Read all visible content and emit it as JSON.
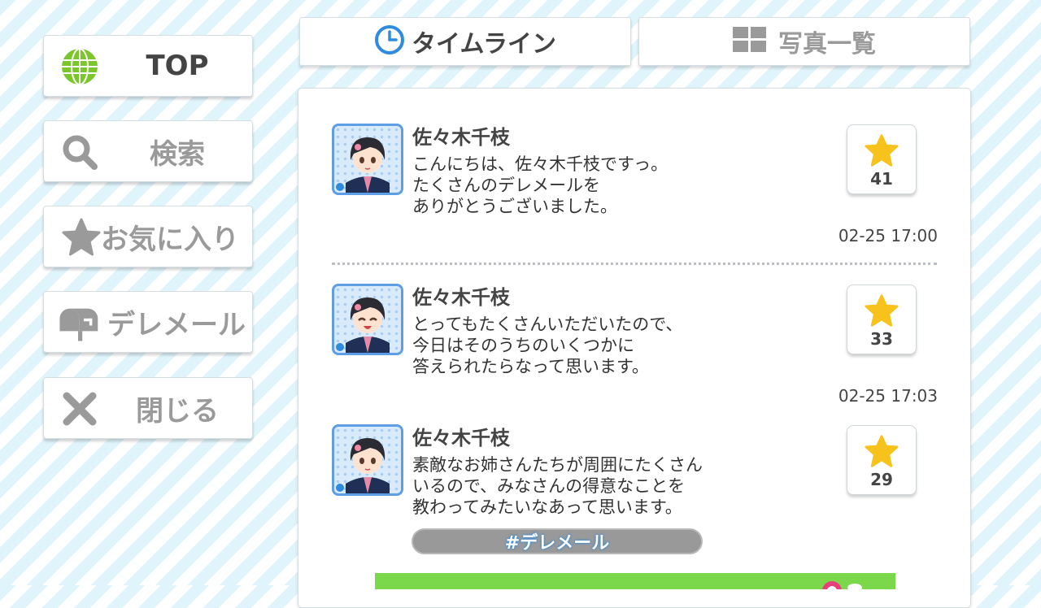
{
  "sidebar": {
    "items": [
      {
        "label": "TOP",
        "icon": "globe-icon"
      },
      {
        "label": "検索",
        "icon": "search-icon"
      },
      {
        "label": "お気に入り",
        "icon": "star-icon"
      },
      {
        "label": "デレメール",
        "icon": "mailbox-icon"
      },
      {
        "label": "閉じる",
        "icon": "close-icon"
      }
    ]
  },
  "tabs": [
    {
      "label": "タイムライン",
      "icon": "clock-icon",
      "active": true
    },
    {
      "label": "写真一覧",
      "icon": "grid-icon",
      "active": false
    }
  ],
  "posts": [
    {
      "name": "佐々木千枝",
      "lines": [
        "こんにちは、佐々木千枝ですっ。",
        "たくさんのデレメールを",
        "ありがとうございました。"
      ],
      "time": "02-25 17:00",
      "likes": "41"
    },
    {
      "name": "佐々木千枝",
      "lines": [
        "とってもたくさんいただいたので、",
        "今日はそのうちのいくつかに",
        "答えられたらなって思います。"
      ],
      "time": "02-25 17:03",
      "likes": "33"
    },
    {
      "name": "佐々木千枝",
      "lines": [
        "素敵なお姉さんたちが周囲にたくさん",
        "いるので、みなさんの得意なことを",
        "教わってみたいなあって思います。"
      ],
      "likes": "29",
      "hashtag": "#デレメール"
    }
  ],
  "colors": {
    "accent_blue": "#2e8be0",
    "star_yellow": "#f7c21b",
    "globe_green": "#7bc62a",
    "banner_green": "#7ad84a"
  }
}
